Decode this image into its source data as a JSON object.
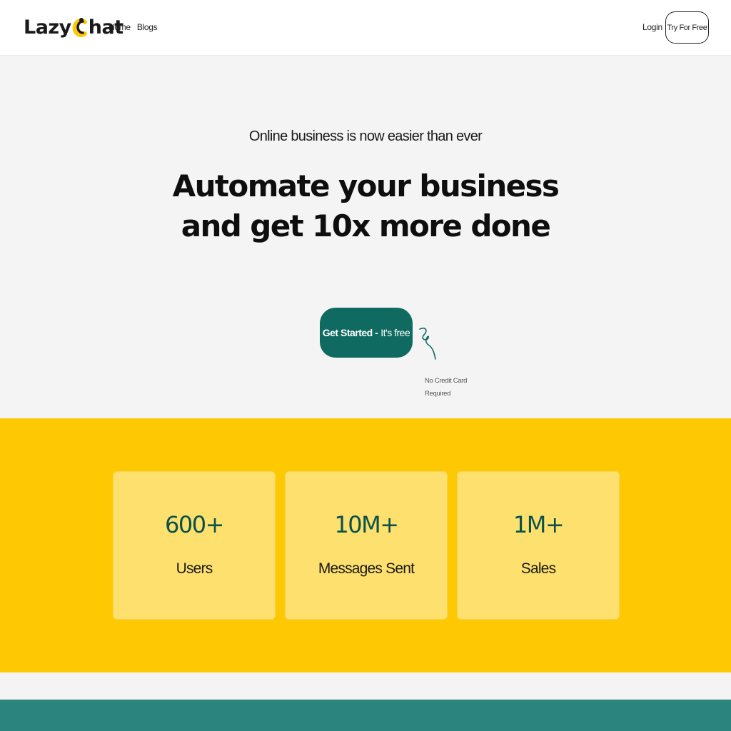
{
  "navbar": {
    "logo_left": "Lazy",
    "logo_right": "hat",
    "links": [
      "Home",
      "Blogs"
    ],
    "login": "Login",
    "try_button": "Try For Free"
  },
  "hero": {
    "subtitle": "Online business is now easier than ever",
    "title_line1": "Automate your business",
    "title_line2": "and get 10x more done",
    "cta_strong": "Get Started -",
    "cta_light": "It's free",
    "note": "No Credit Card Required"
  },
  "stats": [
    {
      "value": "600+",
      "label": "Users"
    },
    {
      "value": "10M+",
      "label": "Messages Sent"
    },
    {
      "value": "1M+",
      "label": "Sales"
    }
  ],
  "colors": {
    "brand_teal": "#0f6b61",
    "stats_yellow": "#fec903",
    "card_yellow": "#fde06e",
    "footer_teal": "#2b847e"
  },
  "icons": [
    "lazychat-logo-icon",
    "squiggle-arrow-icon"
  ]
}
